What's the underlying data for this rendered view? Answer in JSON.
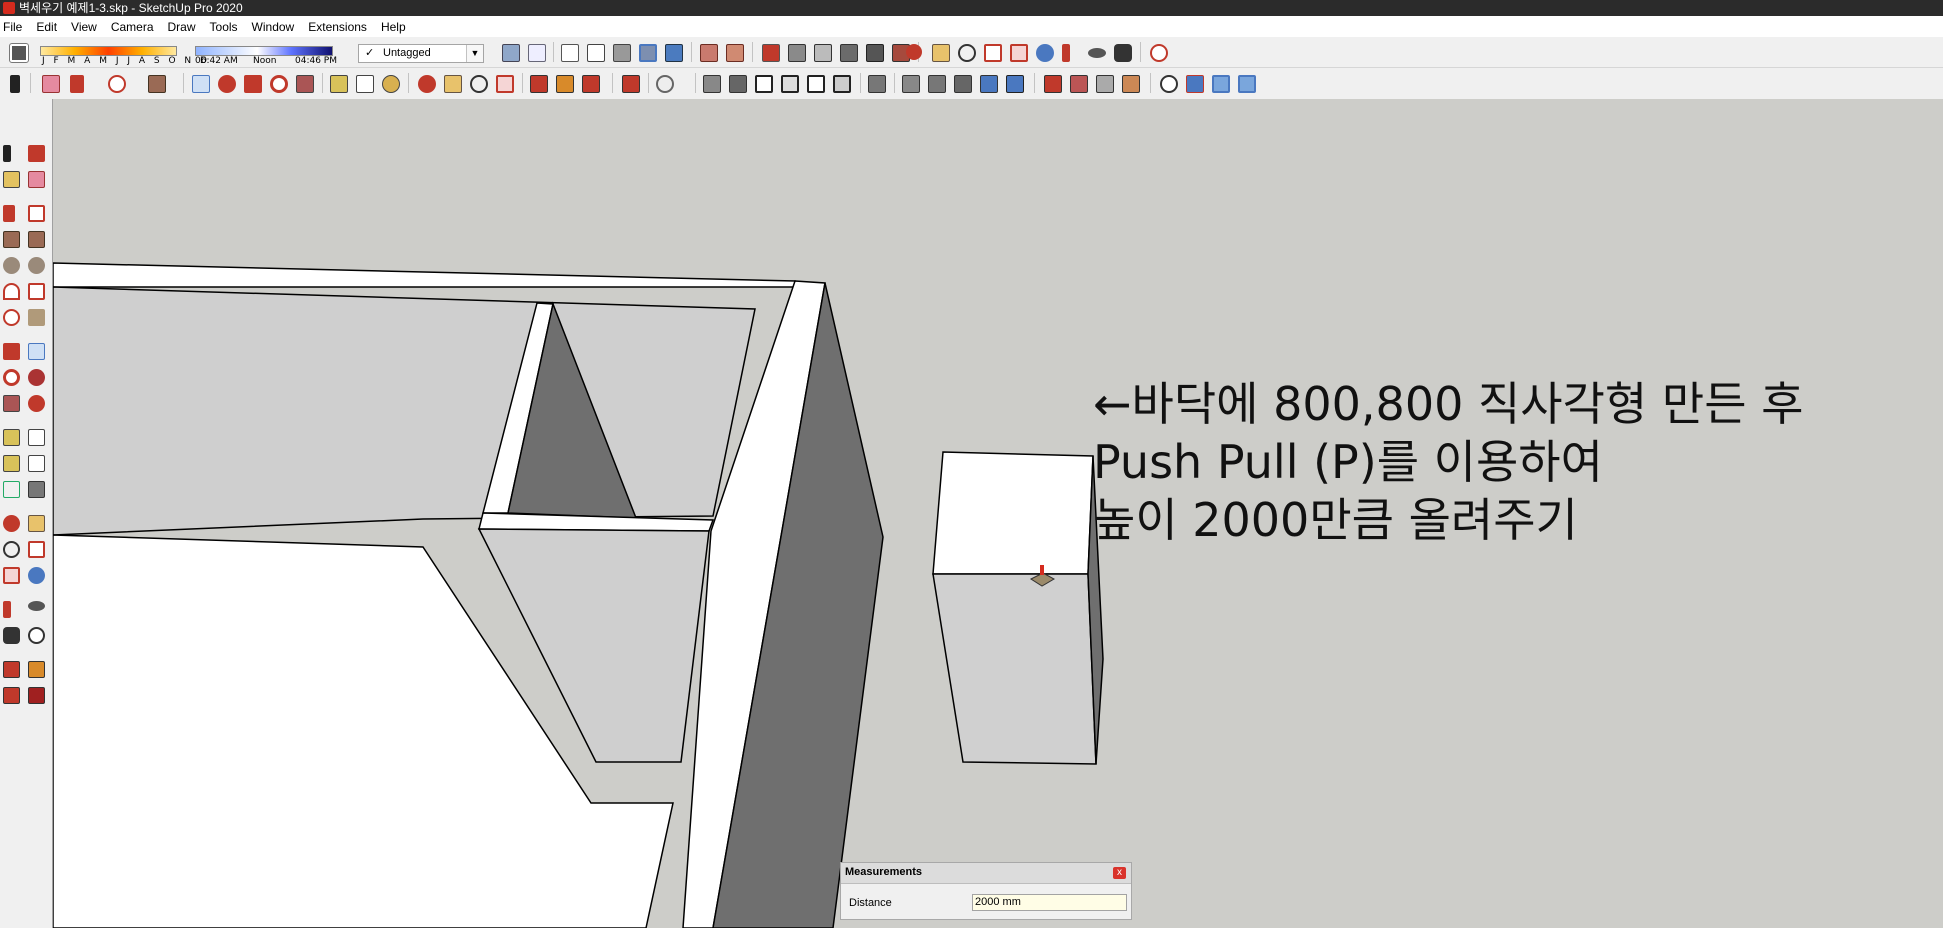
{
  "window": {
    "title": "벽세우기 예제1-3.skp - SketchUp Pro 2020"
  },
  "menu": [
    "File",
    "Edit",
    "View",
    "Camera",
    "Draw",
    "Tools",
    "Window",
    "Extensions",
    "Help"
  ],
  "shadows": {
    "months": "J F M A M J J A S O N D",
    "time_start": "06:42 AM",
    "time_mid": "Noon",
    "time_end": "04:46 PM"
  },
  "tag": {
    "check": "✓",
    "value": "Untagged"
  },
  "annotation": {
    "line1": "←바닥에 800,800 직사각형 만든 후",
    "line2": "Push Pull (P)를 이용하여",
    "line3": "높이 2000만큼 올려주기"
  },
  "measurements": {
    "title": "Measurements",
    "label": "Distance",
    "value": "2000 mm",
    "close": "x"
  },
  "colors": {
    "sky": "#cdcdc9",
    "face_front": "#ffffff",
    "face_gray": "#d0d0d0",
    "face_dark": "#6f6f6f",
    "accent_red": "#d52b1e"
  }
}
